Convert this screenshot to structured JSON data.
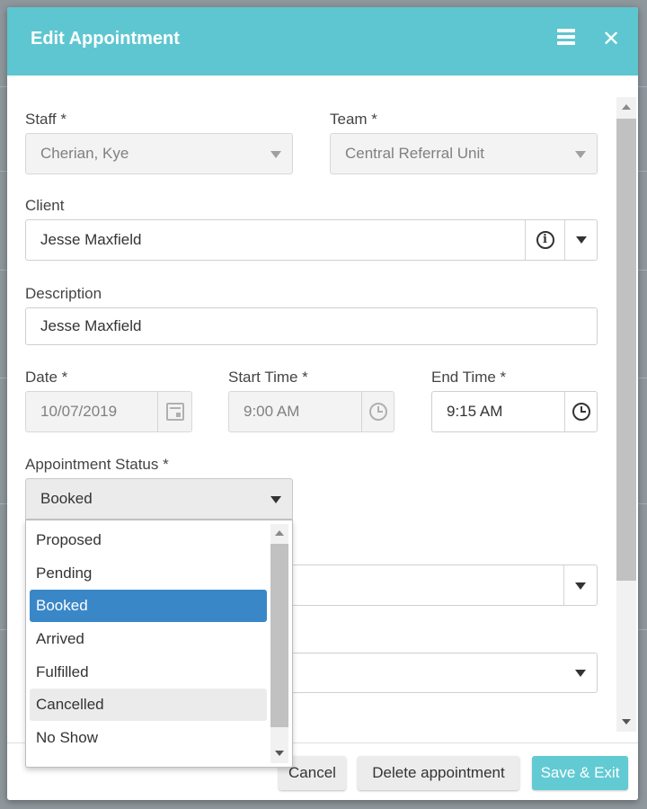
{
  "dialog": {
    "title": "Edit Appointment",
    "menu_icon": "hamburger-menu-icon",
    "close_icon": "close-icon",
    "close_glyph": "✕"
  },
  "form": {
    "staff": {
      "label": "Staff *",
      "value": "Cherian, Kye"
    },
    "team": {
      "label": "Team *",
      "value": "Central Referral Unit"
    },
    "client": {
      "label": "Client",
      "value": "Jesse Maxfield",
      "info_glyph": "i"
    },
    "description": {
      "label": "Description",
      "value": "Jesse Maxfield"
    },
    "date": {
      "label": "Date *",
      "value": "10/07/2019"
    },
    "start_time": {
      "label": "Start Time *",
      "value": "9:00 AM"
    },
    "end_time": {
      "label": "End Time *",
      "value": "9:15 AM"
    },
    "appointment_status": {
      "label": "Appointment Status *",
      "value": "Booked",
      "options": [
        "Proposed",
        "Pending",
        "Booked",
        "Arrived",
        "Fulfilled",
        "Cancelled",
        "No Show"
      ],
      "selected": "Booked",
      "hovered": "Cancelled"
    }
  },
  "footer": {
    "cancel_label": "Cancel",
    "delete_label": "Delete appointment",
    "save_label": "Save & Exit"
  },
  "colors": {
    "header": "#5ec6d0",
    "primary_button": "#62cad3",
    "selected_option": "#3a87c8"
  }
}
